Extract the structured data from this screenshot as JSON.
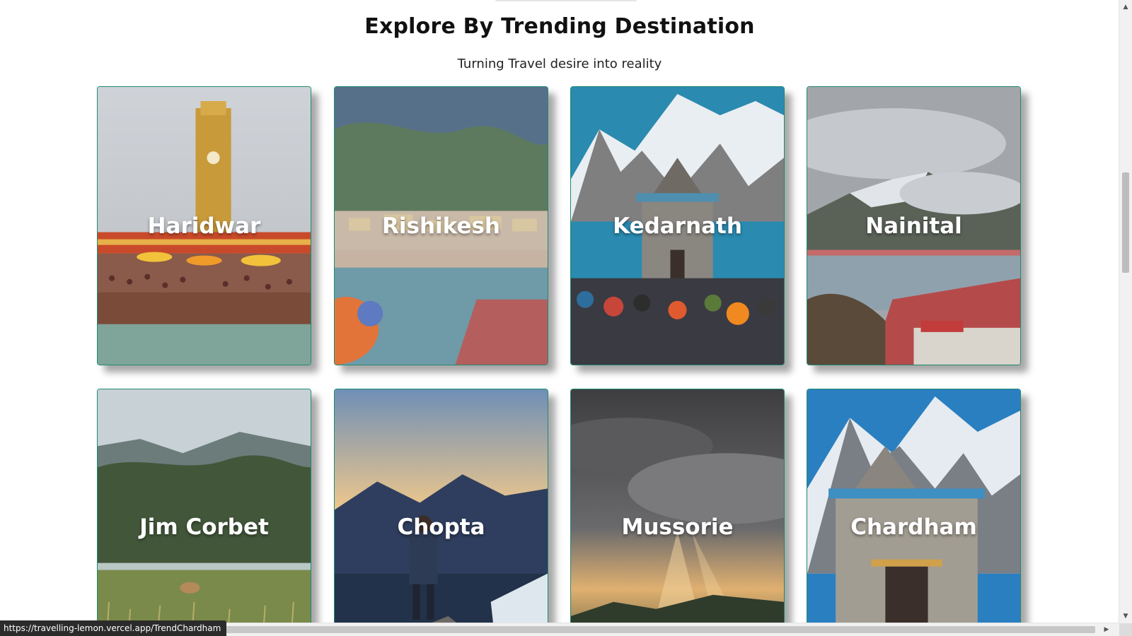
{
  "section": {
    "title": "Explore By Trending Destination",
    "subtitle": "Turning Travel desire into reality"
  },
  "destinations": [
    {
      "name": "Haridwar"
    },
    {
      "name": "Rishikesh"
    },
    {
      "name": "Kedarnath"
    },
    {
      "name": "Nainital"
    },
    {
      "name": "Jim Corbet"
    },
    {
      "name": "Chopta"
    },
    {
      "name": "Mussorie"
    },
    {
      "name": "Chardham"
    }
  ],
  "status_bar": {
    "url": "https://travelling-lemon.vercel.app/TrendChardham"
  },
  "colors": {
    "card_border": "#1f8a70",
    "label_text": "#ffffff",
    "heading_text": "#111111"
  }
}
